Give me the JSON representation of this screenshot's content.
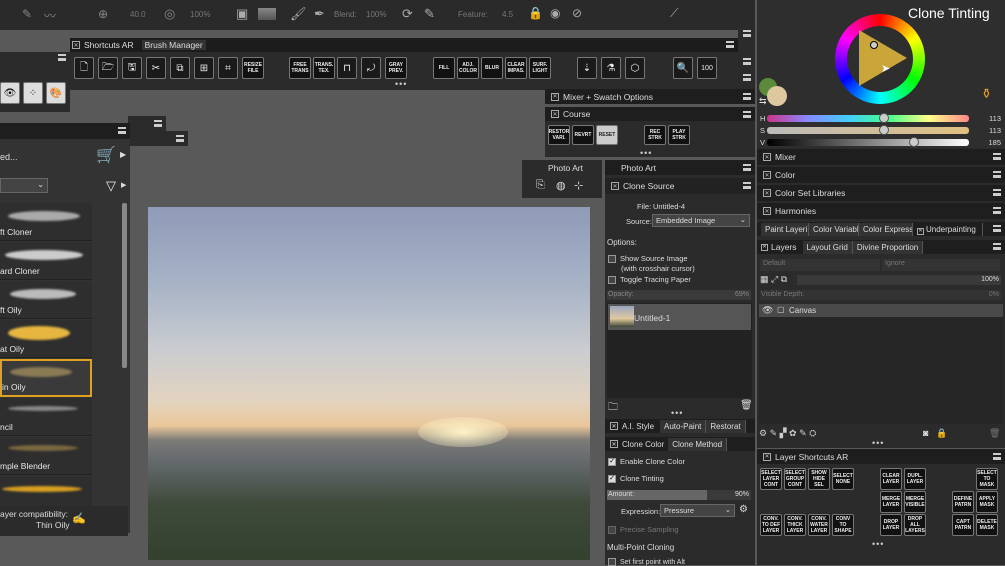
{
  "top_toolbar": {
    "size_value": "40.0",
    "opacity_value": "100%",
    "blend_label": "Blend:",
    "blend_value": "100%",
    "feature_label": "Feature:",
    "feature_value": "4.5"
  },
  "shortcuts_panel": {
    "tabs": [
      "Shortcuts AR",
      "Brush Manager"
    ],
    "text_buttons": [
      "RESIZE FILE",
      "FREE TRANS",
      "TRANS. TEX.",
      "GRAY PREV.",
      "FILL",
      "ADJ. COLOR",
      "BLUR",
      "CLEAR IMPAS.",
      "SURF. LIGHT"
    ]
  },
  "left_panel": {
    "search_text": "ed...",
    "brushes": [
      "ft Cloner",
      "ard Cloner",
      "ft Oily",
      "at Oily",
      "in Oily",
      "ncil",
      "mple Blender"
    ],
    "compat_label": "ayer compatibility:",
    "compat_value": "Thin Oily"
  },
  "mixer_swatch": {
    "title": "Mixer + Swatch Options"
  },
  "course": {
    "title": "Course",
    "buttons": [
      "RESTOR VARI.",
      "REVRT",
      "RESET",
      "REC STRK",
      "PLAY STRK"
    ]
  },
  "photo_art": {
    "tab": "Photo Art",
    "title": "Photo Art"
  },
  "clone_source": {
    "title": "Clone Source",
    "file_label": "File:",
    "file_value": "Untitled-4",
    "source_label": "Source:",
    "source_value": "Embedded Image",
    "options_label": "Options:",
    "show_source": "Show Source Image",
    "crosshair_note": "(with crosshair cursor)",
    "toggle_tracing": "Toggle Tracing Paper",
    "opacity_label": "Opacity:",
    "opacity_value": "69%",
    "item_name": "Untitled-1"
  },
  "ai_style": {
    "tabs": [
      "A.I. Style",
      "Auto-Paint",
      "Restorat"
    ]
  },
  "clone_color": {
    "tabs": [
      "Clone Color",
      "Clone Method"
    ],
    "enable_clone_color": "Enable Clone Color",
    "clone_tinting": "Clone Tinting",
    "amount_label": "Amount:",
    "amount_value": "90%",
    "expression_label": "Expression:",
    "expression_value": "Pressure",
    "precise_sampling": "Precise Sampling",
    "multipoint": "Multi-Point Cloning",
    "first_point": "Set first point with Alt"
  },
  "color_wheel": {
    "title": "Clone Tinting",
    "h_label": "H",
    "h_value": "113",
    "s_label": "S",
    "s_value": "113",
    "v_label": "V",
    "v_value": "185",
    "h_level": 0.58,
    "s_level": 0.58,
    "v_level": 0.73
  },
  "right_panels": {
    "mixer": "Mixer",
    "color": "Color",
    "color_set": "Color Set Libraries",
    "harmonies": "Harmonies",
    "tabs": [
      "Paint Layeri",
      "Color Variabl",
      "Color Express",
      "Underpainting"
    ]
  },
  "layers": {
    "tabs": [
      "Layers",
      "Layout Grid",
      "Divine Proportion"
    ],
    "composite": "Default",
    "ignore": "Ignore",
    "opacity_value": "100%",
    "visible_depth_label": "Visible Depth:",
    "visible_depth_value": "0%",
    "canvas_layer": "Canvas"
  },
  "layer_shortcuts": {
    "title": "Layer Shortcuts AR",
    "buttons": [
      "SELECT LAYER CONT",
      "SELECT GROUP CONT",
      "SHOW HIDE SEL",
      "SELECT NONE",
      "CLEAR LAYER",
      "DUPL. LAYER",
      "SELECT TO MASK",
      "MERGE LAYER",
      "MERGE VISIBLE",
      "DEFINE PATRN",
      "APPLY MASK",
      "CONV. TO DEF LAYER",
      "CONV. THICK LAYER",
      "CONV. WATER LAYER",
      "CONV TO SHAPE",
      "DROP LAYER",
      "DROP ALL LAYERS",
      "CAPT PATRN",
      "DELETE MASK"
    ]
  },
  "colors": {
    "accent_yellow": "#d9b23a",
    "bg": "#595959",
    "panel": "#2b2b2b"
  }
}
